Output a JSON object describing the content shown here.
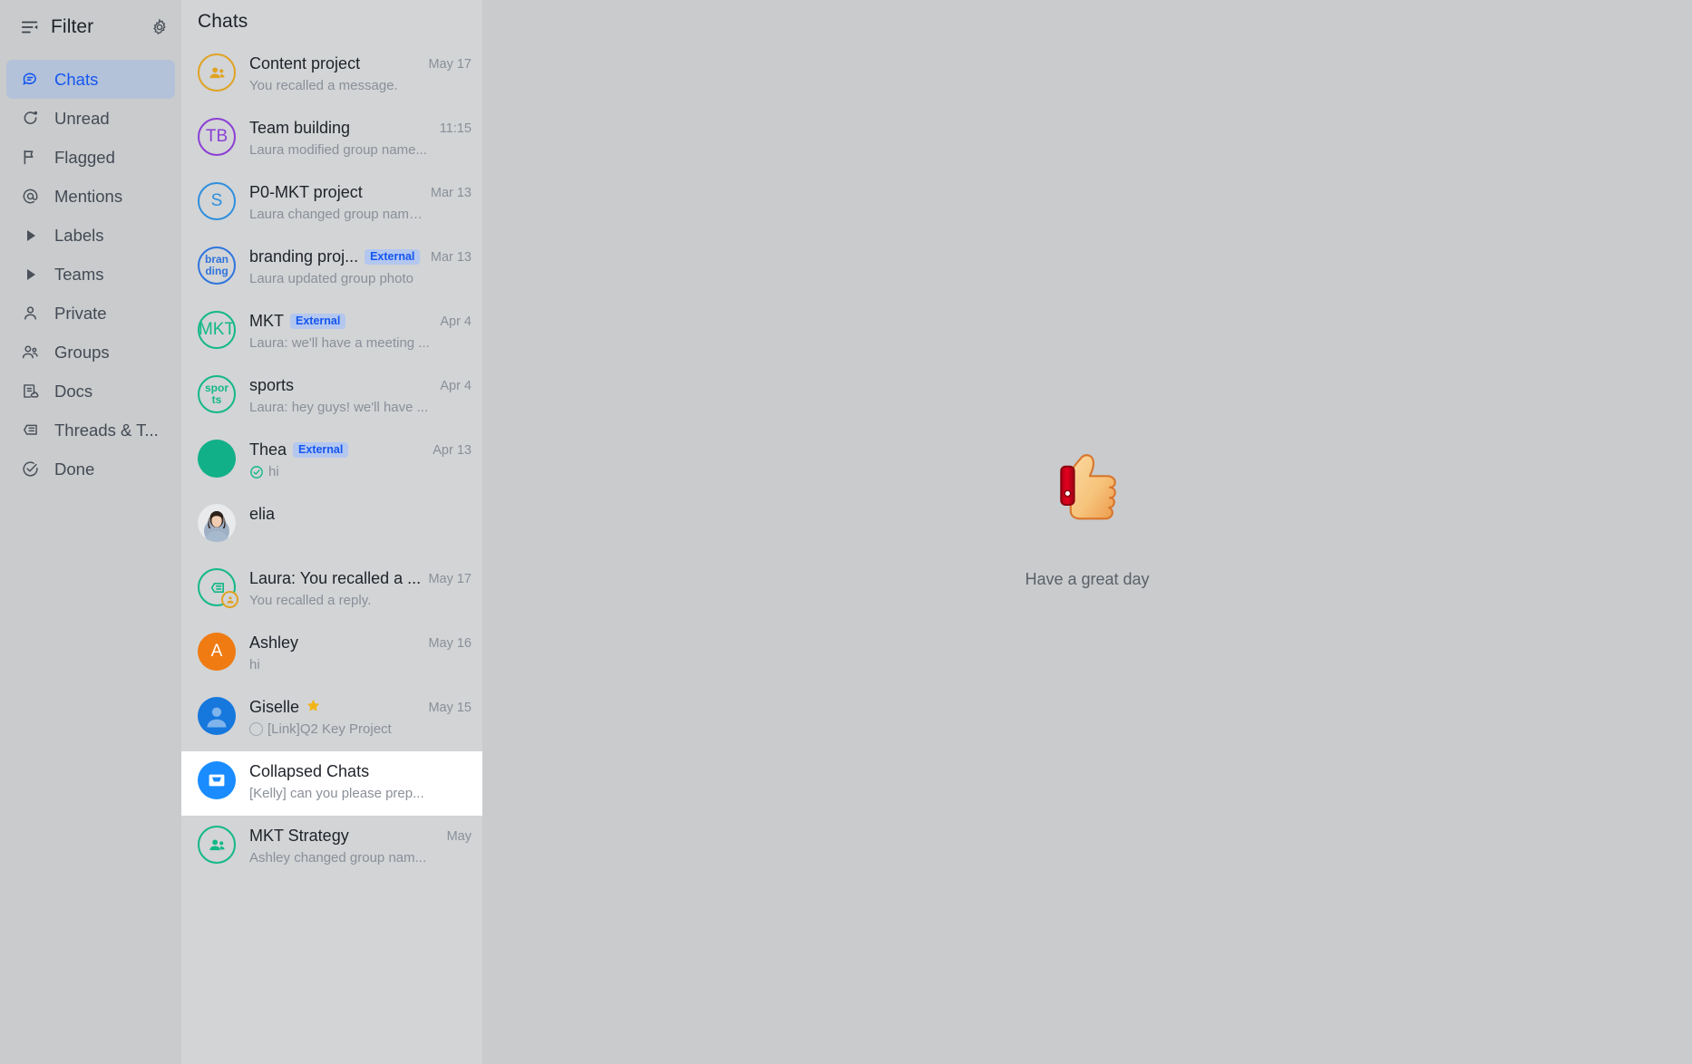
{
  "sidebar": {
    "header": {
      "filter_label": "Filter",
      "filter_icon": "filter-list-icon",
      "settings_icon": "gear-icon"
    },
    "items": [
      {
        "label": "Chats",
        "icon": "chat-bubble-icon",
        "active": true,
        "caret": false
      },
      {
        "label": "Unread",
        "icon": "unread-dot-icon",
        "active": false,
        "caret": false
      },
      {
        "label": "Flagged",
        "icon": "flag-icon",
        "active": false,
        "caret": false
      },
      {
        "label": "Mentions",
        "icon": "at-sign-icon",
        "active": false,
        "caret": false
      },
      {
        "label": "Labels",
        "icon": "chevron-right-icon",
        "active": false,
        "caret": true
      },
      {
        "label": "Teams",
        "icon": "chevron-right-icon",
        "active": false,
        "caret": true
      },
      {
        "label": "Private",
        "icon": "person-icon",
        "active": false,
        "caret": false
      },
      {
        "label": "Groups",
        "icon": "people-icon",
        "active": false,
        "caret": false
      },
      {
        "label": "Docs",
        "icon": "docs-cloud-icon",
        "active": false,
        "caret": false
      },
      {
        "label": "Threads & T...",
        "icon": "thread-icon",
        "active": false,
        "caret": false
      },
      {
        "label": "Done",
        "icon": "check-circle-icon",
        "active": false,
        "caret": false
      }
    ]
  },
  "chat_panel": {
    "title": "Chats",
    "rows": [
      {
        "name": "Content project",
        "preview": "You recalled a message.",
        "time": "May 17",
        "badge": null,
        "star": false,
        "avatar": {
          "style": "ring",
          "color": "#e0a322",
          "glyph": "people-icon",
          "text": ""
        },
        "sub_icon": null,
        "selected": false
      },
      {
        "name": "Team building",
        "preview": "Laura modified group name...",
        "time": "11:15",
        "badge": null,
        "star": false,
        "avatar": {
          "style": "ring",
          "color": "#8b3fd4",
          "glyph": null,
          "text": "TB"
        },
        "sub_icon": null,
        "selected": false
      },
      {
        "name": "P0-MKT project",
        "preview": "Laura changed group name ...",
        "time": "Mar 13",
        "badge": null,
        "star": false,
        "avatar": {
          "style": "ring",
          "color": "#2f8fdd",
          "glyph": null,
          "text": "S"
        },
        "sub_icon": null,
        "selected": false
      },
      {
        "name": "branding proj...",
        "preview": "Laura updated group photo",
        "time": "Mar 13",
        "badge": "External",
        "star": false,
        "avatar": {
          "style": "ring",
          "color": "#2f74dd",
          "glyph": null,
          "text": "bran\nding"
        },
        "sub_icon": null,
        "selected": false
      },
      {
        "name": "MKT",
        "preview": "Laura: we'll have a meeting ...",
        "time": "Apr 4",
        "badge": "External",
        "star": false,
        "avatar": {
          "style": "ring",
          "color": "#12b886",
          "glyph": null,
          "text": "MKT"
        },
        "sub_icon": null,
        "selected": false
      },
      {
        "name": "sports",
        "preview": "Laura: hey guys! we'll have ...",
        "time": "Apr 4",
        "badge": null,
        "star": false,
        "avatar": {
          "style": "ring",
          "color": "#12b886",
          "glyph": null,
          "text": "spor\nts"
        },
        "sub_icon": null,
        "selected": false
      },
      {
        "name": "Thea",
        "preview": "hi",
        "time": "Apr 13",
        "badge": "External",
        "star": false,
        "avatar": {
          "style": "solid",
          "color": "#11b088",
          "glyph": null,
          "text": ""
        },
        "sub_icon": "check-circle-icon",
        "selected": false
      },
      {
        "name": "elia",
        "preview": "",
        "time": "",
        "badge": null,
        "star": false,
        "avatar": {
          "style": "photo",
          "color": "#b9c3cd",
          "glyph": "user-photo",
          "text": ""
        },
        "sub_icon": null,
        "selected": false
      },
      {
        "name": "Laura: You recalled a ...",
        "preview": "You recalled a reply.",
        "time": "May 17",
        "badge": null,
        "star": false,
        "avatar": {
          "style": "ring",
          "color": "#12b886",
          "glyph": "thread-icon",
          "text": ""
        },
        "corner_badge": "recall-icon",
        "sub_icon": null,
        "selected": false
      },
      {
        "name": "Ashley",
        "preview": "hi",
        "time": "May 16",
        "badge": null,
        "star": false,
        "avatar": {
          "style": "solid",
          "color": "#ef7b12",
          "glyph": null,
          "text": "A"
        },
        "sub_icon": null,
        "selected": false
      },
      {
        "name": "Giselle",
        "preview": "[Link]Q2 Key Project",
        "time": "May 15",
        "badge": null,
        "star": true,
        "avatar": {
          "style": "solid",
          "color": "#1677dd",
          "glyph": "person-silhouette-icon",
          "text": ""
        },
        "sub_icon": "empty-circle-icon",
        "selected": false
      },
      {
        "name": "Collapsed Chats",
        "preview": "[Kelly] can you please prep...",
        "time": "",
        "badge": null,
        "star": false,
        "avatar": {
          "style": "solid",
          "color": "#1a8cff",
          "glyph": "inbox-icon",
          "text": ""
        },
        "sub_icon": null,
        "selected": true
      },
      {
        "name": "MKT Strategy",
        "preview": "Ashley changed group nam...",
        "time": "May",
        "badge": null,
        "star": false,
        "avatar": {
          "style": "ring",
          "color": "#12b886",
          "glyph": "people-icon",
          "text": ""
        },
        "sub_icon": null,
        "selected": false
      }
    ]
  },
  "main_panel": {
    "empty_emoji": "thumbs-up-emoji",
    "empty_text": "Have a great day"
  },
  "colors": {
    "accent": "#1456f0",
    "sidebar_bg": "#c9cbcd",
    "list_bg": "#d2d4d6",
    "selected_bg": "#ffffff",
    "external_badge_bg": "#b3c7ef",
    "external_badge_fg": "#1456f0"
  },
  "cursor": {
    "icon": "tap-hand-cursor"
  }
}
